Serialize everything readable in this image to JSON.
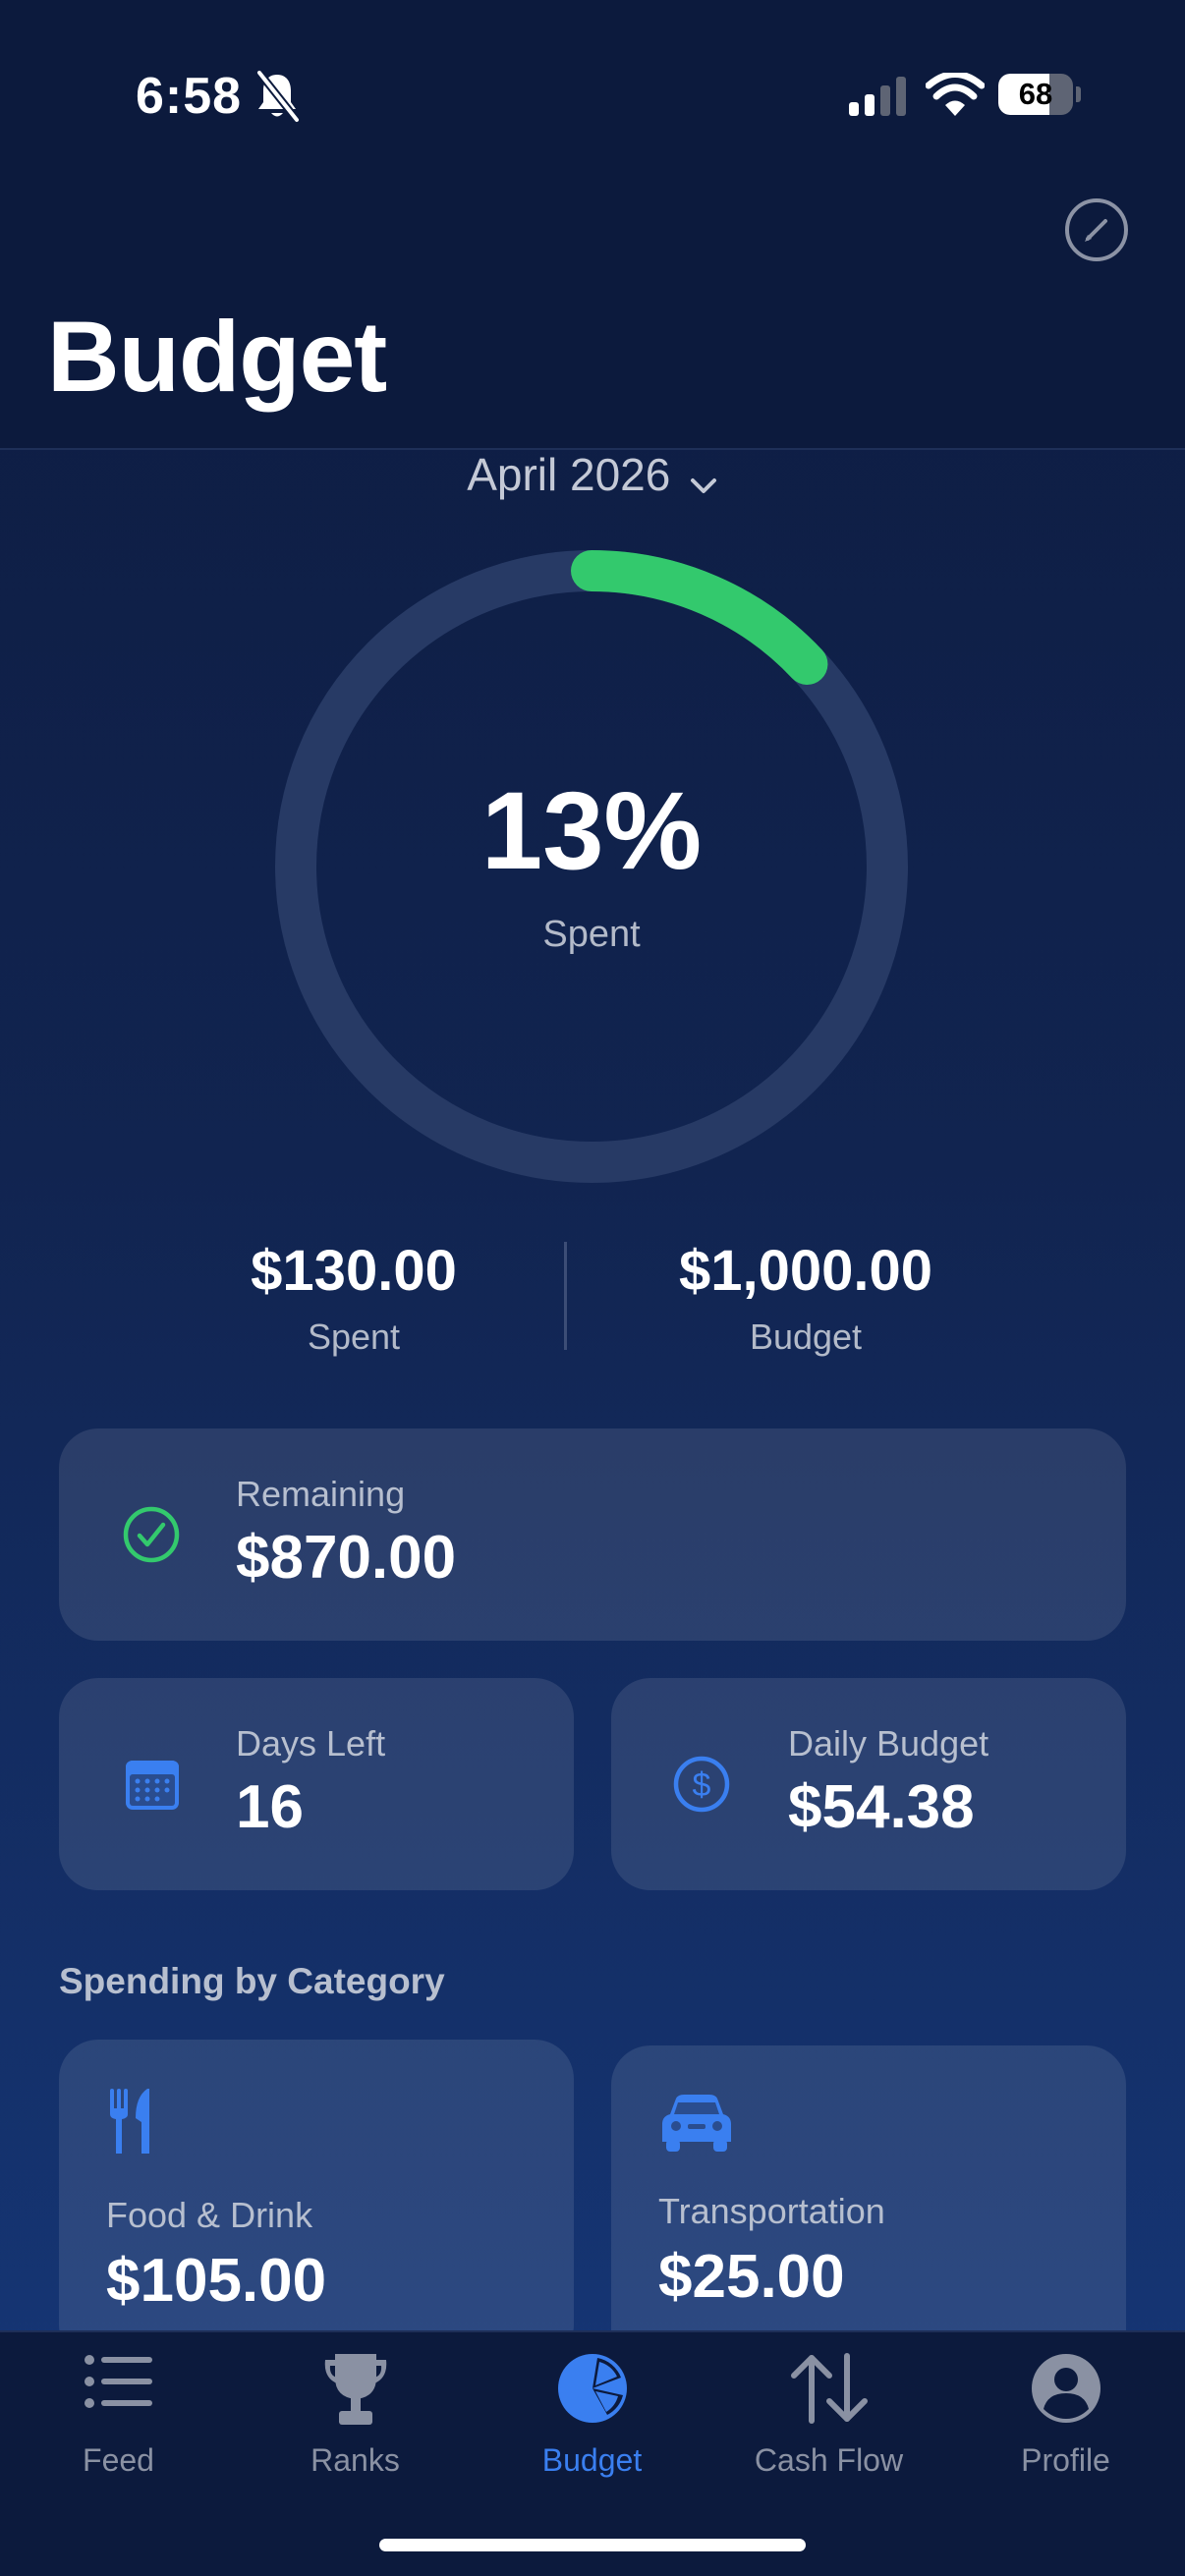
{
  "status_bar": {
    "time": "6:58",
    "battery": "68",
    "battery_level_percent": 68
  },
  "header": {
    "title": "Budget",
    "edit_icon": "pencil-circle-icon"
  },
  "month_picker": {
    "label": "April 2026"
  },
  "progress": {
    "percent_label": "13%",
    "percent_value": 13,
    "sub_label": "Spent",
    "track_color": "#273a65",
    "progress_color": "#33c96d"
  },
  "summary": {
    "spent_amount": "$130.00",
    "spent_label": "Spent",
    "budget_amount": "$1,000.00",
    "budget_label": "Budget"
  },
  "remaining": {
    "label": "Remaining",
    "value": "$870.00",
    "icon": "checkmark-circle-icon",
    "icon_color": "#33c96d"
  },
  "days_left": {
    "label": "Days Left",
    "value": "16",
    "icon": "calendar-icon",
    "icon_color": "#3a7ff0"
  },
  "daily_budget": {
    "label": "Daily Budget",
    "value": "$54.38",
    "icon": "dollar-circle-icon",
    "icon_color": "#3a7ff0"
  },
  "categories": {
    "section_title": "Spending by Category",
    "items": [
      {
        "label": "Food & Drink",
        "value": "$105.00",
        "icon": "fork-knife-icon"
      },
      {
        "label": "Transportation",
        "value": "$25.00",
        "icon": "car-icon"
      }
    ]
  },
  "tabbar": {
    "tabs": [
      {
        "label": "Feed",
        "icon": "list-icon",
        "active": false
      },
      {
        "label": "Ranks",
        "icon": "trophy-icon",
        "active": false
      },
      {
        "label": "Budget",
        "icon": "pie-chart-icon",
        "active": true
      },
      {
        "label": "Cash Flow",
        "icon": "arrows-up-down-icon",
        "active": false
      },
      {
        "label": "Profile",
        "icon": "person-circle-icon",
        "active": false
      }
    ],
    "active_color": "#3a7ff0",
    "inactive_color": "#8a91a3"
  }
}
